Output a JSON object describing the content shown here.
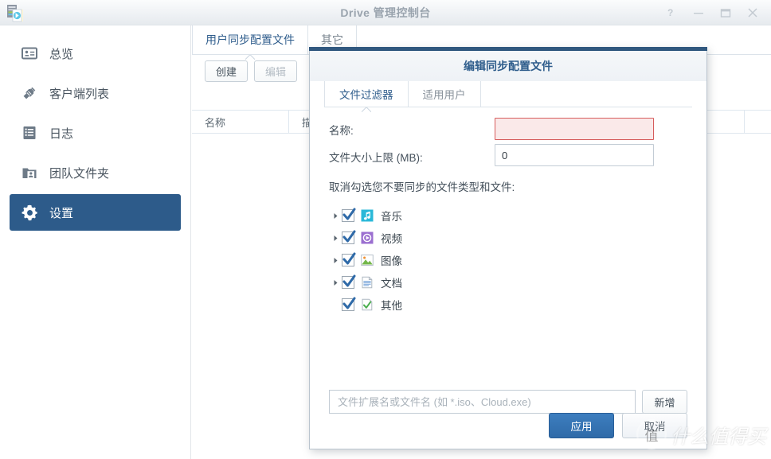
{
  "window": {
    "title": "Drive 管理控制台",
    "app_icon": "drive-app-icon",
    "controls": [
      {
        "name": "help-button",
        "glyph": "?"
      },
      {
        "name": "minimize-button",
        "glyph": "—"
      },
      {
        "name": "maximize-button",
        "glyph": "□"
      },
      {
        "name": "close-button",
        "glyph": "✕"
      }
    ]
  },
  "sidebar": {
    "items": [
      {
        "label": "总览",
        "icon": "overview-card-icon",
        "active": false
      },
      {
        "label": "客户端列表",
        "icon": "plug-connector-icon",
        "active": false
      },
      {
        "label": "日志",
        "icon": "log-list-icon",
        "active": false
      },
      {
        "label": "团队文件夹",
        "icon": "team-folder-icon",
        "active": false
      },
      {
        "label": "设置",
        "icon": "gear-icon",
        "active": true
      }
    ],
    "active_color": "#2d5b8a"
  },
  "main": {
    "tabs": [
      {
        "label": "用户同步配置文件",
        "active": true
      },
      {
        "label": "其它",
        "active": false
      }
    ],
    "toolbar": [
      {
        "label": "创建",
        "disabled": false
      },
      {
        "label": "编辑",
        "disabled": true
      }
    ],
    "table_headers": [
      "名称",
      "描述"
    ]
  },
  "dialog": {
    "title": "编辑同步配置文件",
    "accent_color": "#31587f",
    "tabs": [
      {
        "label": "文件过滤器",
        "active": true
      },
      {
        "label": "适用用户",
        "active": false
      }
    ],
    "fields": {
      "name_label": "名称:",
      "name_value": "",
      "name_error": true,
      "size_label": "文件大小上限 (MB):",
      "size_value": "0"
    },
    "instruction": "取消勾选您不要同步的文件类型和文件:",
    "tree": [
      {
        "label": "音乐",
        "checked": true,
        "expandable": true,
        "icon": "music-note-icon",
        "icon_color": "#29b8d8"
      },
      {
        "label": "视频",
        "checked": true,
        "expandable": true,
        "icon": "video-play-icon",
        "icon_color": "#9b6fd0"
      },
      {
        "label": "图像",
        "checked": true,
        "expandable": true,
        "icon": "image-picture-icon",
        "icon_color": "#74b74a"
      },
      {
        "label": "文档",
        "checked": true,
        "expandable": true,
        "icon": "document-page-icon",
        "icon_color": "#6f9fd8"
      },
      {
        "label": "其他",
        "checked": true,
        "expandable": false,
        "icon": "other-check-icon",
        "icon_color": "#4caf50"
      }
    ],
    "ext_input_placeholder": "文件扩展名或文件名 (如 *.iso、Cloud.exe)",
    "ext_input_value": "",
    "add_button": "新增",
    "apply_button": "应用",
    "cancel_button": "取消"
  },
  "watermark": {
    "mark": "值",
    "text": "什么值得买"
  }
}
